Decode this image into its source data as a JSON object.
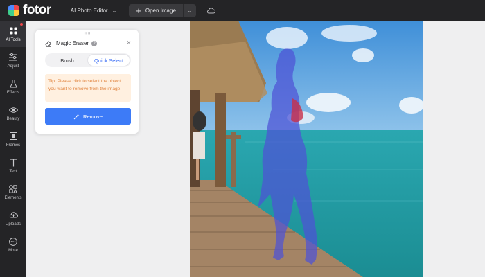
{
  "app": {
    "logo_text": "fotor"
  },
  "topbar": {
    "editor_label": "AI Photo Editor",
    "open_label": "Open Image"
  },
  "sidebar": {
    "items": [
      {
        "label": "AI Tools",
        "icon": "grid-icon",
        "active": true
      },
      {
        "label": "Adjust",
        "icon": "sliders-icon"
      },
      {
        "label": "Effects",
        "icon": "flask-icon"
      },
      {
        "label": "Beauty",
        "icon": "eye-icon"
      },
      {
        "label": "Frames",
        "icon": "frame-icon"
      },
      {
        "label": "Text",
        "icon": "text-icon"
      },
      {
        "label": "Elements",
        "icon": "shapes-icon"
      },
      {
        "label": "Uploads",
        "icon": "cloud-upload-icon"
      },
      {
        "label": "More",
        "icon": "more-icon"
      }
    ]
  },
  "panel": {
    "title": "Magic Eraser",
    "tabs": [
      {
        "label": "Brush"
      },
      {
        "label": "Quick Select"
      }
    ],
    "tip": "Tip: Please click to select the object you want to remove from the image.",
    "remove_label": "Remove"
  },
  "colors": {
    "accent": "#3d7bf7",
    "tip_text": "#e0823c",
    "tip_bg": "#fff0e0",
    "dark_bar": "#242426"
  }
}
